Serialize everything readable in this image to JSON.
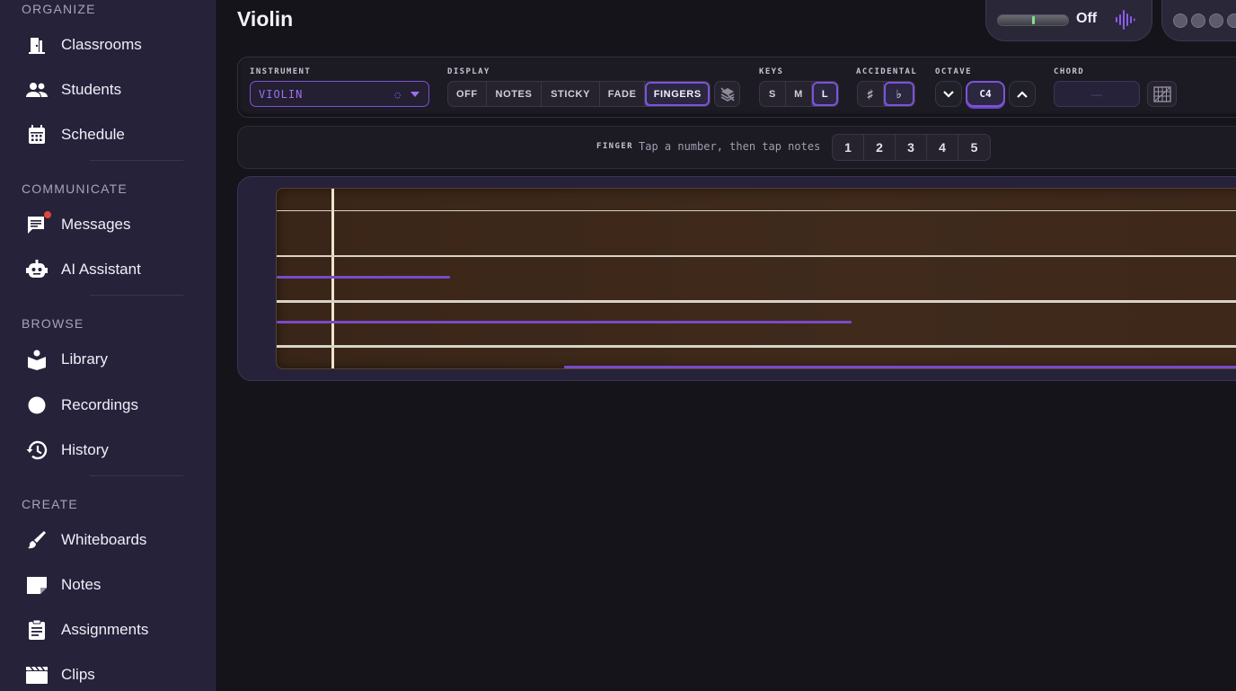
{
  "sidebar": {
    "sections": [
      {
        "title": "ORGANIZE",
        "items": [
          {
            "label": "Classrooms",
            "icon": "door-icon"
          },
          {
            "label": "Students",
            "icon": "people-icon"
          },
          {
            "label": "Schedule",
            "icon": "calendar-icon"
          }
        ]
      },
      {
        "title": "COMMUNICATE",
        "items": [
          {
            "label": "Messages",
            "icon": "chat-icon",
            "badge": "unread-dot"
          },
          {
            "label": "AI Assistant",
            "icon": "robot-icon"
          }
        ]
      },
      {
        "title": "BROWSE",
        "items": [
          {
            "label": "Library",
            "icon": "book-icon"
          },
          {
            "label": "Recordings",
            "icon": "record-icon"
          },
          {
            "label": "History",
            "icon": "history-icon"
          }
        ]
      },
      {
        "title": "CREATE",
        "items": [
          {
            "label": "Whiteboards",
            "icon": "brush-icon"
          },
          {
            "label": "Notes",
            "icon": "note-icon"
          },
          {
            "label": "Assignments",
            "icon": "clipboard-icon"
          },
          {
            "label": "Clips",
            "icon": "clapper-icon"
          }
        ]
      }
    ]
  },
  "header": {
    "title": "Violin",
    "audio": {
      "status": "Off",
      "icon": "waveform-icon"
    }
  },
  "controls": {
    "instrument": {
      "label": "INSTRUMENT",
      "value": "VIOLIN"
    },
    "display": {
      "label": "DISPLAY",
      "options": [
        "OFF",
        "NOTES",
        "STICKY",
        "FADE",
        "FINGERS"
      ],
      "active": "FINGERS",
      "extra_icon": "layers-off-icon"
    },
    "keys": {
      "label": "KEYS",
      "options": [
        "S",
        "M",
        "L"
      ],
      "active": "L"
    },
    "accidental": {
      "label": "ACCIDENTAL",
      "options": [
        "♯",
        "♭"
      ],
      "active": "♭"
    },
    "octave": {
      "label": "OCTAVE",
      "value": "C4"
    },
    "chord": {
      "label": "CHORD",
      "value": "—",
      "icon": "chord-grid-icon"
    }
  },
  "finger_bar": {
    "label": "FINGER",
    "hint": "Tap a number, then tap notes",
    "numbers": [
      "1",
      "2",
      "3",
      "4",
      "5"
    ]
  },
  "colors": {
    "accent": "#7b55d6",
    "sidebar_bg": "#26223a",
    "page_bg": "#16141b",
    "fretboard": "#3f2a1c",
    "badge": "#e0463c"
  }
}
